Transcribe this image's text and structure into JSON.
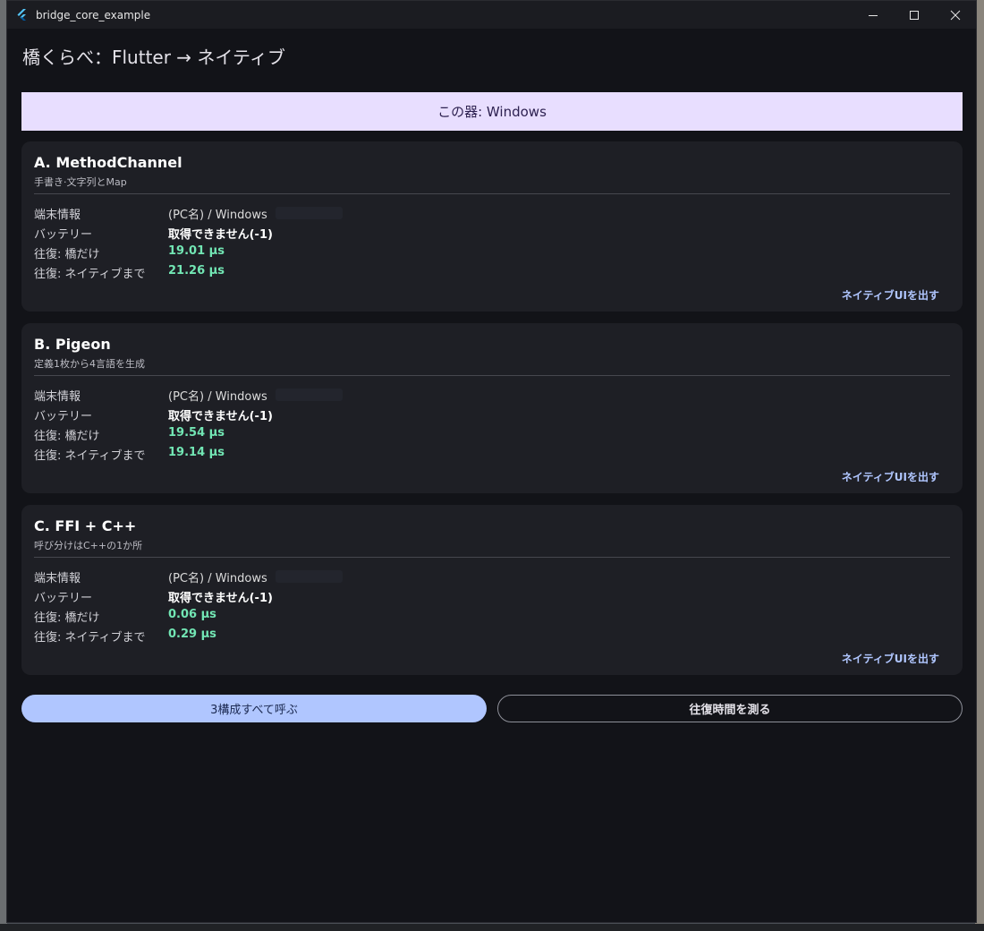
{
  "window": {
    "title": "bridge_core_example"
  },
  "appbar": {
    "title": "橋くらべ：Flutter → ネイティブ"
  },
  "banner": {
    "text": "この器: Windows"
  },
  "labels": {
    "device_info": "端末情報",
    "battery": "バッテリー",
    "roundtrip_bridge": "往復: 橋だけ",
    "roundtrip_native": "往復: ネイティブまで"
  },
  "cards": [
    {
      "title": "A. MethodChannel",
      "subtitle": "手書き·文字列とMap",
      "device_info": "(PC名) / Windows",
      "battery": "取得できません(-1)",
      "roundtrip_bridge": "19.01 µs",
      "roundtrip_native": "21.26 µs",
      "action": "ネイティブUIを出す"
    },
    {
      "title": "B. Pigeon",
      "subtitle": "定義1枚から4言語を生成",
      "device_info": "(PC名) / Windows",
      "battery": "取得できません(-1)",
      "roundtrip_bridge": "19.54 µs",
      "roundtrip_native": "19.14 µs",
      "action": "ネイティブUIを出す"
    },
    {
      "title": "C. FFI + C++",
      "subtitle": "呼び分けはC++の1か所",
      "device_info": "(PC名) / Windows",
      "battery": "取得できません(-1)",
      "roundtrip_bridge": "0.06 µs",
      "roundtrip_native": "0.29 µs",
      "action": "ネイティブUIを出す"
    }
  ],
  "buttons": {
    "call_all": "3構成すべて呼ぶ",
    "measure": "往復時間を測る"
  },
  "colors": {
    "background": "#121318",
    "card": "#1e1f25",
    "banner": "#e8deff",
    "accent": "#b0c6ff",
    "timing": "#72e6b4"
  },
  "icons": {
    "app": "flutter-icon",
    "minimize": "minimize-icon",
    "maximize": "maximize-icon",
    "close": "close-icon"
  }
}
